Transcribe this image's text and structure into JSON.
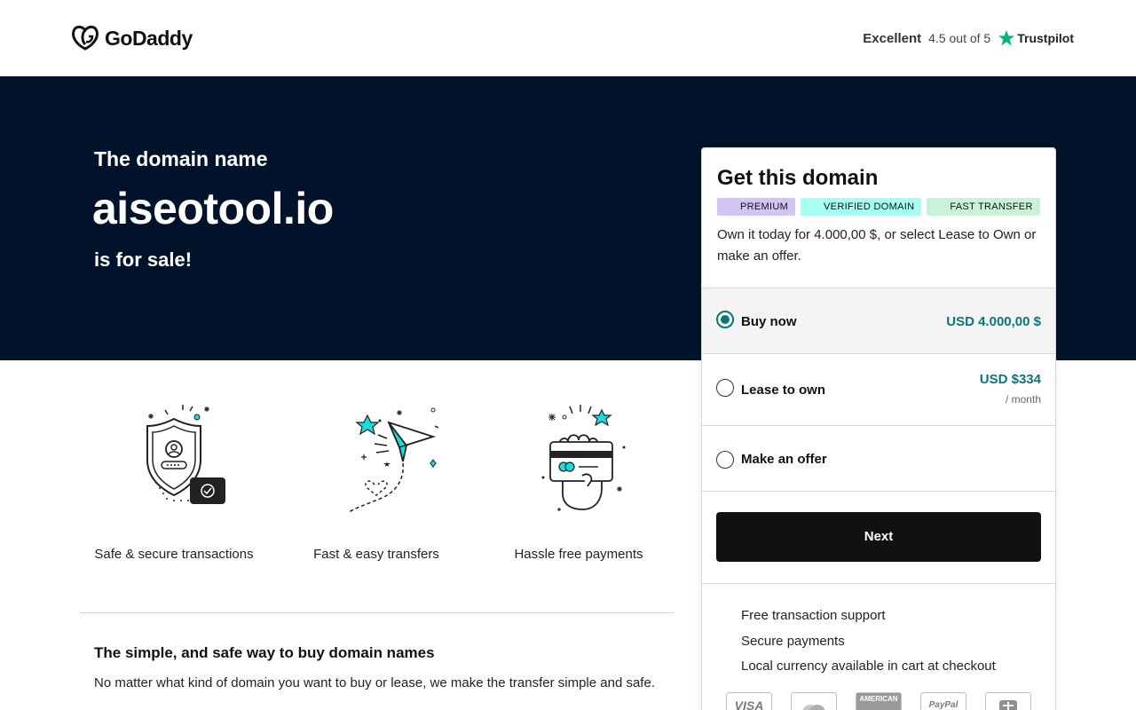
{
  "header": {
    "brand": "GoDaddy",
    "rating_label": "Excellent",
    "rating_score": "4.5 out of 5",
    "trustpilot": "Trustpilot"
  },
  "hero": {
    "pre": "The domain name",
    "domain": "aiseotool.io",
    "post": "is for sale!",
    "background": "#00132b"
  },
  "features": [
    {
      "label": "Safe & secure transactions",
      "icon": "shield-user-icon"
    },
    {
      "label": "Fast & easy transfers",
      "icon": "paper-plane-icon"
    },
    {
      "label": "Hassle free payments",
      "icon": "hand-card-icon"
    }
  ],
  "info": {
    "title": "The simple, and safe way to buy domain names",
    "text": "No matter what kind of domain you want to buy or lease, we make the transfer simple and safe."
  },
  "card": {
    "title": "Get this domain",
    "badges": [
      "PREMIUM",
      "VERIFIED DOMAIN",
      "FAST TRANSFER"
    ],
    "description": "Own it today for 4.000,00 $, or select Lease to Own or make an offer.",
    "options": [
      {
        "label": "Buy now",
        "price": "USD 4.000,00 $",
        "selected": true
      },
      {
        "label": "Lease to own",
        "price": "USD $334",
        "sub": "/ month",
        "selected": false
      },
      {
        "label": "Make an offer",
        "selected": false
      }
    ],
    "next_label": "Next",
    "benefits": [
      "Free transaction support",
      "Secure payments",
      "Local currency available in cart at checkout"
    ],
    "payments": [
      "VISA",
      "",
      "AMERICAN",
      "PayPal",
      ""
    ],
    "accent": "#09757a"
  }
}
